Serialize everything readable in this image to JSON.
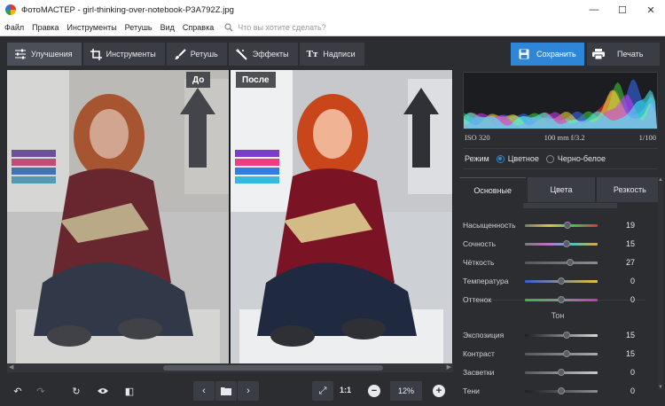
{
  "window": {
    "title": "ФотоМАСТЕР - girl-thinking-over-notebook-P3A792Z.jpg",
    "minimize": "—",
    "maximize": "☐",
    "close": "✕"
  },
  "menu": {
    "items": [
      "Файл",
      "Правка",
      "Инструменты",
      "Ретушь",
      "Вид",
      "Справка"
    ],
    "search_placeholder": "Что вы хотите сделать?"
  },
  "toolbar": {
    "tabs": [
      {
        "label": "Улучшения",
        "icon": "sliders-icon"
      },
      {
        "label": "Инструменты",
        "icon": "crop-icon"
      },
      {
        "label": "Ретушь",
        "icon": "brush-icon"
      },
      {
        "label": "Эффекты",
        "icon": "magic-wand-icon"
      },
      {
        "label": "Надписи",
        "icon": "text-icon",
        "glyph": "Tт"
      }
    ],
    "save": "Сохранить",
    "print": "Печать"
  },
  "preview": {
    "before_label": "До",
    "after_label": "После"
  },
  "bottombar": {
    "undo": "↶",
    "redo": "↷",
    "rotate": "↻",
    "view": "👁",
    "compare": "◧",
    "prev": "‹",
    "next": "›",
    "fullscreen": "⤢",
    "ratio": "1:1",
    "zoom_out": "−",
    "zoom": "12%",
    "zoom_in": "+"
  },
  "histogram": {
    "colors": [
      "#ff3b3b",
      "#3bd13b",
      "#3b6bff",
      "#ffe23b",
      "#d23bff",
      "#3bffff"
    ]
  },
  "exif": {
    "iso": "ISO 320",
    "lens": "100 mm f/3.2",
    "shutter": "1/100"
  },
  "mode": {
    "label": "Режим",
    "color": "Цветное",
    "bw": "Черно-белое"
  },
  "subtabs": [
    "Основные",
    "Цвета",
    "Резкость"
  ],
  "sliders": [
    {
      "label": "Насыщенность",
      "value": "19",
      "level": 0.58,
      "track": "linear-gradient(90deg,#7a7a7a,#d7c64a,#46c246,#d13b3b)"
    },
    {
      "label": "Сочность",
      "value": "15",
      "level": 0.57,
      "track": "linear-gradient(90deg,#7a7a7a,#c46fc4,#4ac2c2,#e2a43b)"
    },
    {
      "label": "Чёткость",
      "value": "27",
      "level": 0.62,
      "track": "linear-gradient(90deg,#55585f,#8a8d94)"
    },
    {
      "label": "Температура",
      "value": "0",
      "level": 0.5,
      "track": "linear-gradient(90deg,#3b5bd1,#8a8d94,#e0c23b)"
    },
    {
      "label": "Оттенок",
      "value": "0",
      "level": 0.5,
      "track": "linear-gradient(90deg,#3bb24a,#8a8d94,#c23bb2)"
    }
  ],
  "tone_section": "Тон",
  "tone_sliders": [
    {
      "label": "Экспозиция",
      "value": "15",
      "level": 0.57,
      "track": "linear-gradient(90deg,#1e1f22,#d8d8d8)"
    },
    {
      "label": "Контраст",
      "value": "15",
      "level": 0.57,
      "track": "linear-gradient(90deg,#55585f,#a8abb2)"
    },
    {
      "label": "Засветки",
      "value": "0",
      "level": 0.5,
      "track": "linear-gradient(90deg,#55585f,#c8cbd2)"
    },
    {
      "label": "Тени",
      "value": "0",
      "level": 0.5,
      "track": "linear-gradient(90deg,#1e1f22,#8a8d94)"
    }
  ]
}
